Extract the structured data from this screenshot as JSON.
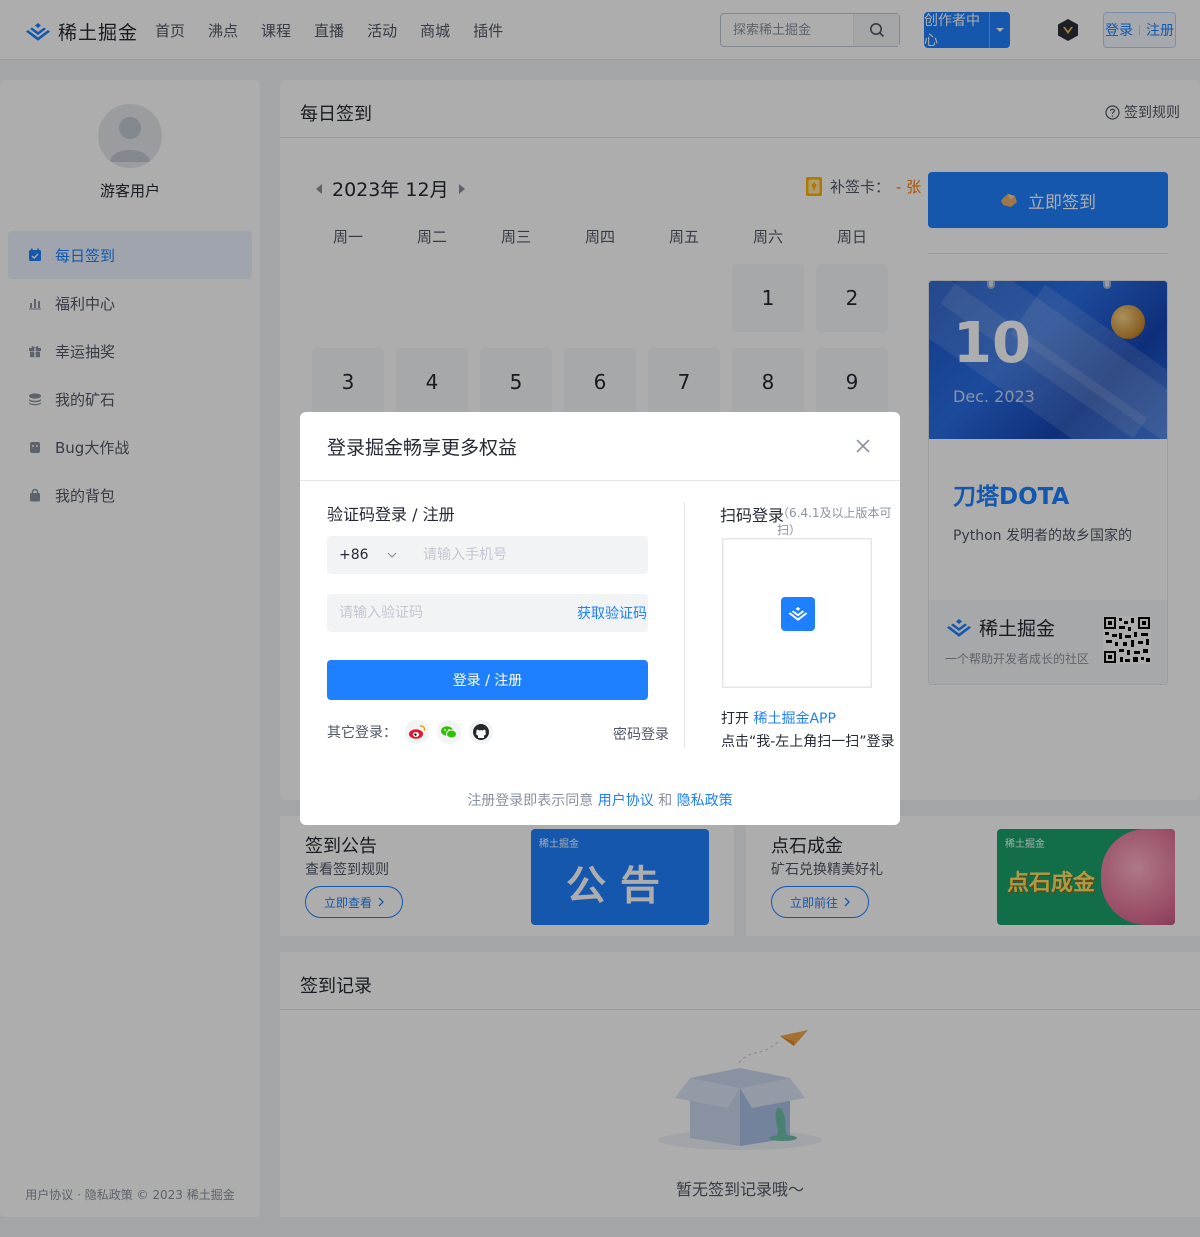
{
  "header": {
    "logo_text": "稀土掘金",
    "nav": [
      "首页",
      "沸点",
      "课程",
      "直播",
      "活动",
      "商城",
      "插件"
    ],
    "search_placeholder": "探索稀土掘金",
    "create_label": "创作者中心",
    "login_label": "登录",
    "register_label": "注册"
  },
  "sidebar": {
    "username": "游客用户",
    "items": [
      {
        "label": "每日签到",
        "icon": "calendar-check-icon"
      },
      {
        "label": "福利中心",
        "icon": "bar-chart-icon"
      },
      {
        "label": "幸运抽奖",
        "icon": "gift-icon"
      },
      {
        "label": "我的矿石",
        "icon": "coins-stack-icon"
      },
      {
        "label": "Bug大作战",
        "icon": "bug-icon"
      },
      {
        "label": "我的背包",
        "icon": "bag-icon"
      }
    ],
    "footer": "用户协议 · 隐私政策 © 2023 稀土掘金"
  },
  "checkin": {
    "title": "每日签到",
    "rules": "签到规则",
    "month": "2023年 12月",
    "miss_card_label": "补签卡：",
    "miss_card_value": "- 张",
    "weekdays": [
      "周一",
      "周二",
      "周三",
      "周四",
      "周五",
      "周六",
      "周日"
    ],
    "days": [
      "",
      "",
      "",
      "",
      "",
      "1",
      "2",
      "3",
      "4",
      "5",
      "6",
      "7",
      "8",
      "9"
    ],
    "button": "立即签到",
    "date_card": {
      "day": "10",
      "month": "Dec. 2023",
      "highlight": "刀塔DOTA",
      "desc": "Python 发明者的故乡国家的",
      "foot_logo": "稀土掘金",
      "foot_text": "一个帮助开发者成长的社区"
    }
  },
  "promos": [
    {
      "title": "签到公告",
      "sub": "查看签到规则",
      "button": "立即查看",
      "img_logo": "稀土掘金",
      "img_text": "公告"
    },
    {
      "title": "点石成金",
      "sub": "矿石兑换精美好礼",
      "button": "立即前往",
      "img_logo": "稀土掘金",
      "img_text": "点石成金"
    }
  ],
  "record": {
    "title": "签到记录",
    "empty": "暂无签到记录哦～"
  },
  "modal": {
    "title": "登录掘金畅享更多权益",
    "sub": "验证码登录 / 注册",
    "country_code": "+86",
    "phone_placeholder": "请输入手机号",
    "code_placeholder": "请输入验证码",
    "get_code": "获取验证码",
    "submit": "登录 / 注册",
    "other_login": "其它登录：",
    "pwd_login": "密码登录",
    "scan_title": "扫码登录",
    "scan_note": "（6.4.1及以上版本可扫）",
    "scan_line1_prefix": "打开 ",
    "scan_line1_link": "稀土掘金APP",
    "scan_line2": "点击“我-左上角扫一扫”登录",
    "agree_prefix": "注册登录即表示同意 ",
    "agree_link1": "用户协议",
    "agree_mid": " 和 ",
    "agree_link2": "隐私政策"
  },
  "colors": {
    "brand": "#1e80ff",
    "overlay": "rgba(0,0,0,0.32)"
  }
}
